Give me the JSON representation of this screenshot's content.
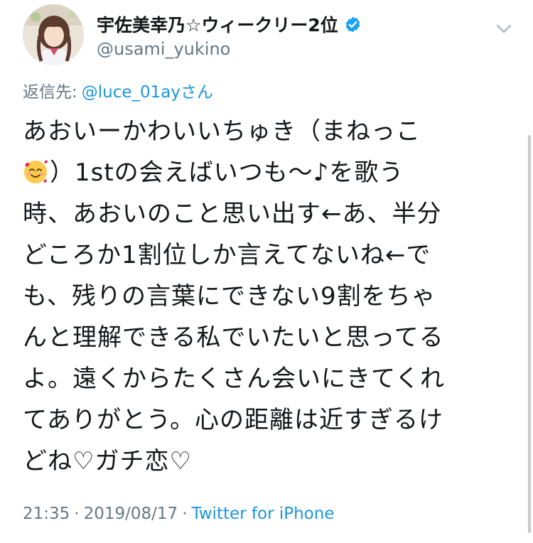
{
  "author": {
    "display_name": "宇佐美幸乃☆ウィークリー2位",
    "handle": "@usami_yukino",
    "avatar_icon": "profile-photo",
    "verified_icon": "verified-badge-icon"
  },
  "reply": {
    "label": "返信先:",
    "mention": "@luce_01ayさん"
  },
  "tweet": {
    "line1": "あおいーかわいいちゅき（まねっこ",
    "line2_text": "）1stの会えばいつも〜♪を歌う",
    "line3": "時、あおいのこと思い出す←あ、半分",
    "line4": "どころか1割位しか言えてないね←で",
    "line5": "も、残りの言葉にできない9割をちゃ",
    "line6": "んと理解できる私でいたいと思ってる",
    "line7": "よ。遠くからたくさん会いにきてくれ",
    "line8": "てありがとう。心の距離は近すぎるけ",
    "line9": "どね♡ガチ恋♡",
    "emoji_icon": "smiling-face-with-hearts-icon"
  },
  "meta": {
    "time": "21:35",
    "separator": "·",
    "date": "2019/08/17",
    "source": "Twitter for iPhone"
  },
  "colors": {
    "link": "#1b95e0",
    "secondary_text": "#657786",
    "primary_text": "#14171a"
  }
}
